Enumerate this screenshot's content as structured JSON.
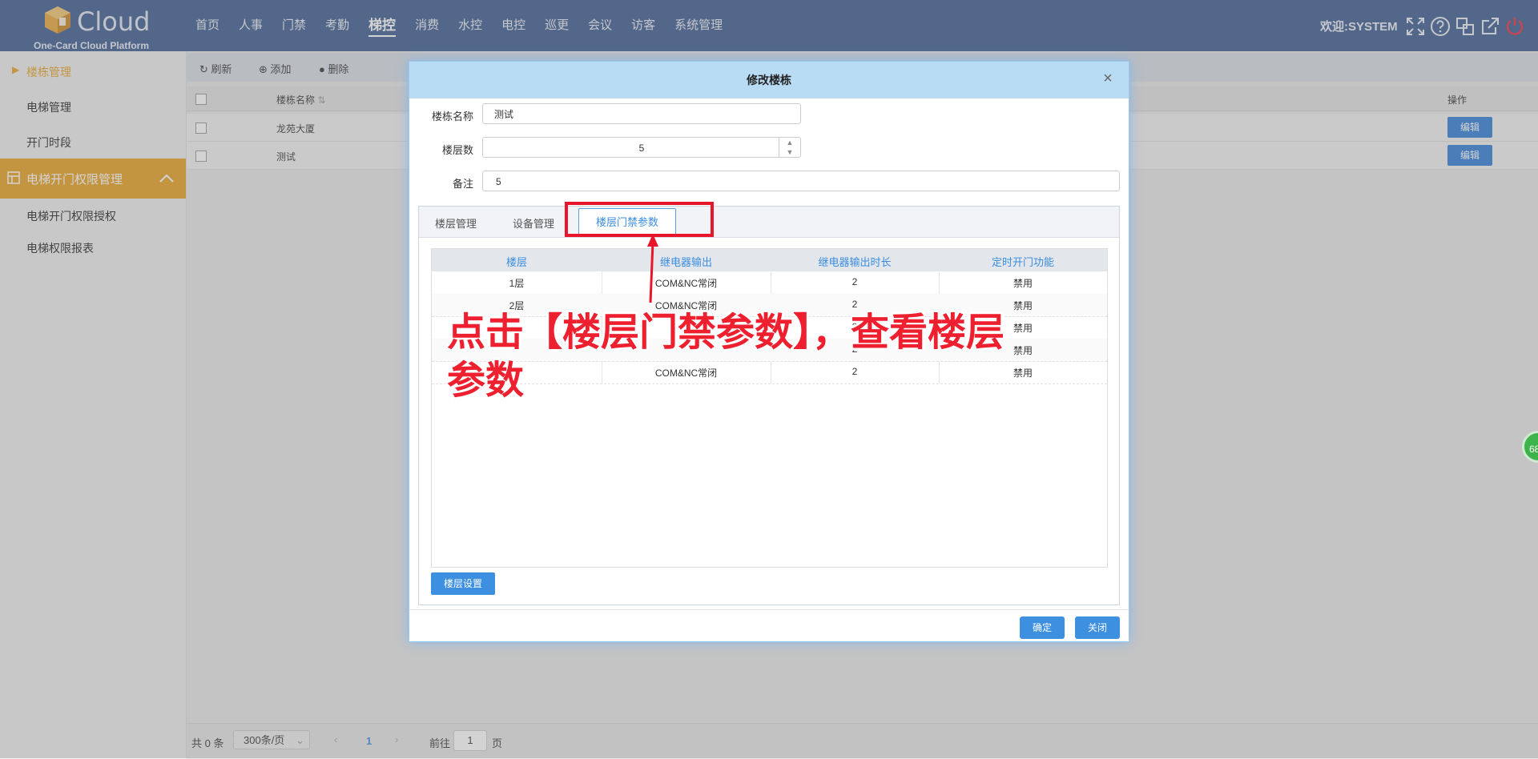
{
  "brand": {
    "name": "Cloud",
    "subtitle": "One-Card Cloud Platform"
  },
  "nav": [
    "首页",
    "人事",
    "门禁",
    "考勤",
    "梯控",
    "消费",
    "水控",
    "电控",
    "巡更",
    "会议",
    "访客",
    "系统管理"
  ],
  "nav_active": "梯控",
  "header": {
    "welcome": "欢迎:SYSTEM"
  },
  "sidebar": {
    "item_active": "楼栋管理",
    "item_2": "电梯管理",
    "item_3": "开门时段",
    "group": "电梯开门权限管理",
    "item_5": "电梯开门权限授权",
    "item_6": "电梯权限报表"
  },
  "toolbar": {
    "refresh": "刷新",
    "add": "添加",
    "delete": "删除"
  },
  "grid": {
    "col_name": "楼栋名称",
    "col_action": "操作",
    "rows": [
      {
        "name": "龙苑大厦",
        "action": "编辑"
      },
      {
        "name": "测试",
        "action": "编辑"
      }
    ]
  },
  "pager": {
    "total": "共 0 条",
    "page_size": "300条/页",
    "current": "1",
    "goto_label": "前往",
    "goto_value": "1",
    "page_unit": "页"
  },
  "dialog": {
    "title": "修改楼栋",
    "fields": {
      "name_label": "楼栋名称",
      "name_value": "测试",
      "floors_label": "楼层数",
      "floors_value": "5",
      "remark_label": "备注",
      "remark_value": "5"
    },
    "tabs": [
      "楼层管理",
      "设备管理",
      "楼层门禁参数"
    ],
    "table": {
      "headers": [
        "楼层",
        "继电器输出",
        "继电器输出时长",
        "定时开门功能"
      ],
      "rows": [
        [
          "1层",
          "COM&NC常闭",
          "2",
          "禁用"
        ],
        [
          "2层",
          "COM&NC常闭",
          "2",
          "禁用"
        ],
        [
          "",
          "",
          "2",
          "禁用"
        ],
        [
          "",
          "",
          "2",
          "禁用"
        ],
        [
          "",
          "COM&NC常闭",
          "2",
          "禁用"
        ]
      ]
    },
    "floor_setting_button": "楼层设置",
    "ok_button": "确定",
    "close_button": "关闭"
  },
  "annotation": {
    "line1": "点击【楼层门禁参数】，查看楼层",
    "line2": "参数"
  },
  "badge": "68",
  "colors": {
    "topbar": "#3a5a8f",
    "sidebar_accent": "#e8a020",
    "primary_button": "#3d8fe0",
    "annotation": "#ee1f2e"
  }
}
